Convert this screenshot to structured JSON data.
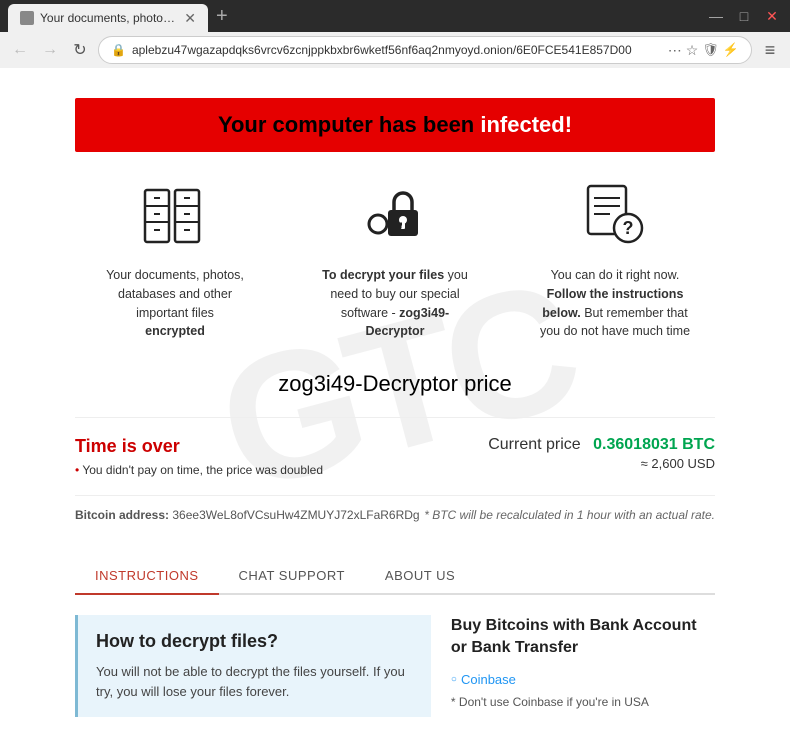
{
  "browser": {
    "tab_title": "Your documents, photos, database",
    "url": "aplebzu47wgazapdqks6vrcv6zcnjppkbxbr6wketf56nf6aq2nmyoyd.onion/6E0FCE541E857D00",
    "new_tab_label": "+",
    "back_btn": "←",
    "forward_btn": "→",
    "refresh_btn": "↻",
    "minimize_btn": "—",
    "maximize_btn": "□",
    "close_btn": "✕",
    "more_btn": "⋯",
    "star_btn": "☆",
    "shield_btn": "🛡",
    "lightning_btn": "⚡",
    "menu_btn": "≡",
    "tab_close": "✕"
  },
  "page": {
    "watermark": "GTC",
    "infected_banner_part1": "Your computer has been ",
    "infected_word": "infected!",
    "icon1_desc_line1": "Your documents, photos,",
    "icon1_desc_line2": "databases and other important files",
    "icon1_desc_bold": "encrypted",
    "icon2_desc_prefix": "To decrypt your files",
    "icon2_desc_suffix": " you need to buy our special software - ",
    "icon2_desc_name": "zog3i49-Decryptor",
    "icon3_desc_prefix": "You can do it right now. ",
    "icon3_desc_bold": "Follow the instructions below.",
    "icon3_desc_suffix": " But remember that you do not have much time",
    "price_title": "zog3i49-Decryptor price",
    "time_over_label": "Time is over",
    "time_note": "You didn't pay on time, the price was doubled",
    "current_price_label": "Current price",
    "btc_price": "0.36018031 BTC",
    "usd_approx": "≈ 2,600 USD",
    "btc_address_label": "Bitcoin address:",
    "btc_address_value": "36ee3WeL8ofVCsuHw4ZMUYJ72xLFaR6RDg",
    "btc_recalc_note": "* BTC will be recalculated in 1 hour with an actual rate.",
    "tab_instructions": "INSTRUCTIONS",
    "tab_chat_support": "CHAT SUPPORT",
    "tab_about_us": "ABOUT US",
    "decrypt_title": "How to decrypt files?",
    "decrypt_body": "You will not be able to decrypt the files yourself. If you try, you will lose your files forever.",
    "buy_btc_title": "Buy Bitcoins with Bank Account or Bank Transfer",
    "coinbase_link": "Coinbase",
    "buy_note": "Don't use Coinbase if you're in USA"
  }
}
